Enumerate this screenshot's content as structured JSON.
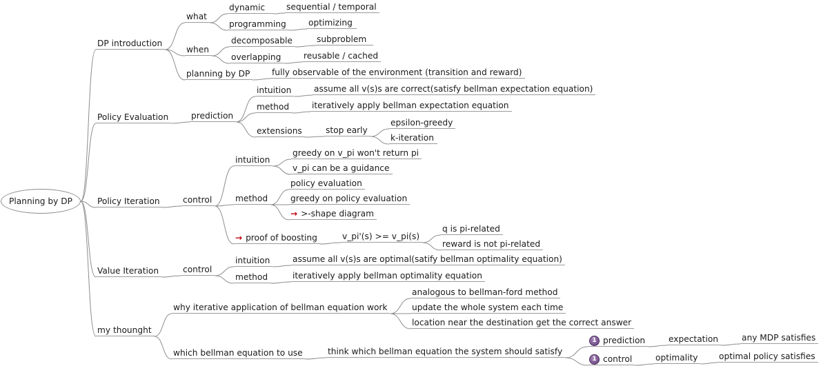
{
  "root": "Planning by DP",
  "nodes": {
    "dp_intro": "DP introduction",
    "what": "what",
    "dynamic": "dynamic",
    "sequential": "sequential / temporal",
    "programming": "programming",
    "optimizing": "optimizing",
    "when": "when",
    "decomposable": "decomposable",
    "subproblem": "subproblem",
    "overlapping": "overlapping",
    "reusable": "reusable / cached",
    "planning_by_dp": "planning by DP",
    "fully_observable": "fully observable of the environment (transition and reward)",
    "policy_eval": "Policy Evaluation",
    "prediction": "prediction",
    "pe_intuition": "intuition",
    "pe_intuition_text": "assume all v(s)s are correct(satisfy bellman expectation equation)",
    "pe_method": "method",
    "pe_method_text": "iteratively apply bellman expectation equation",
    "extensions": "extensions",
    "stop_early": "stop early",
    "epsilon_greedy": "epsilon-greedy",
    "k_iteration": "k-iteration",
    "policy_iter": "Policy Iteration",
    "pi_control": "control",
    "pi_intuition": "intuition",
    "greedy_vpi": "greedy on v_pi won't return pi",
    "vpi_guidance": "v_pi can be a guidance",
    "pi_method": "method",
    "policy_evaluation": "policy evaluation",
    "greedy_policy_eval": "greedy on policy evaluation",
    "shape_diagram": ">-shape diagram",
    "proof_boosting": "proof of boosting",
    "vpi_ineq": "v_pi'(s) >= v_pi(s)",
    "q_pi_related": "q is pi-related",
    "reward_not_pi": "reward is not pi-related",
    "value_iter": "Value Iteration",
    "vi_control": "control",
    "vi_intuition": "intuition",
    "vi_intuition_text": "assume all v(s)s are optimal(satify bellman optimality equation)",
    "vi_method": "method",
    "vi_method_text": "iteratively apply bellman optimality equation",
    "my_thought": "my thounght",
    "why_iterative": "why iterative application of bellman equation work",
    "analogous": "analogous to bellman-ford method",
    "update_whole": "update the whole system each time",
    "location_near": "location near the destination get the correct answer",
    "which_bellman": "which bellman equation to use",
    "think_which": "think which bellman equation the system should satisfy",
    "mt_prediction": "prediction",
    "expectation": "expectation",
    "any_mdp": "any MDP satisfies",
    "mt_control": "control",
    "optimality": "optimality",
    "optimal_policy": "optimal policy satisfies"
  },
  "icons": {
    "arrow": "→",
    "priority": "1"
  },
  "colors": {
    "edge": "#8c8c8c",
    "arrow_icon": "#c0000a",
    "priority_icon": "#5e3c78"
  }
}
